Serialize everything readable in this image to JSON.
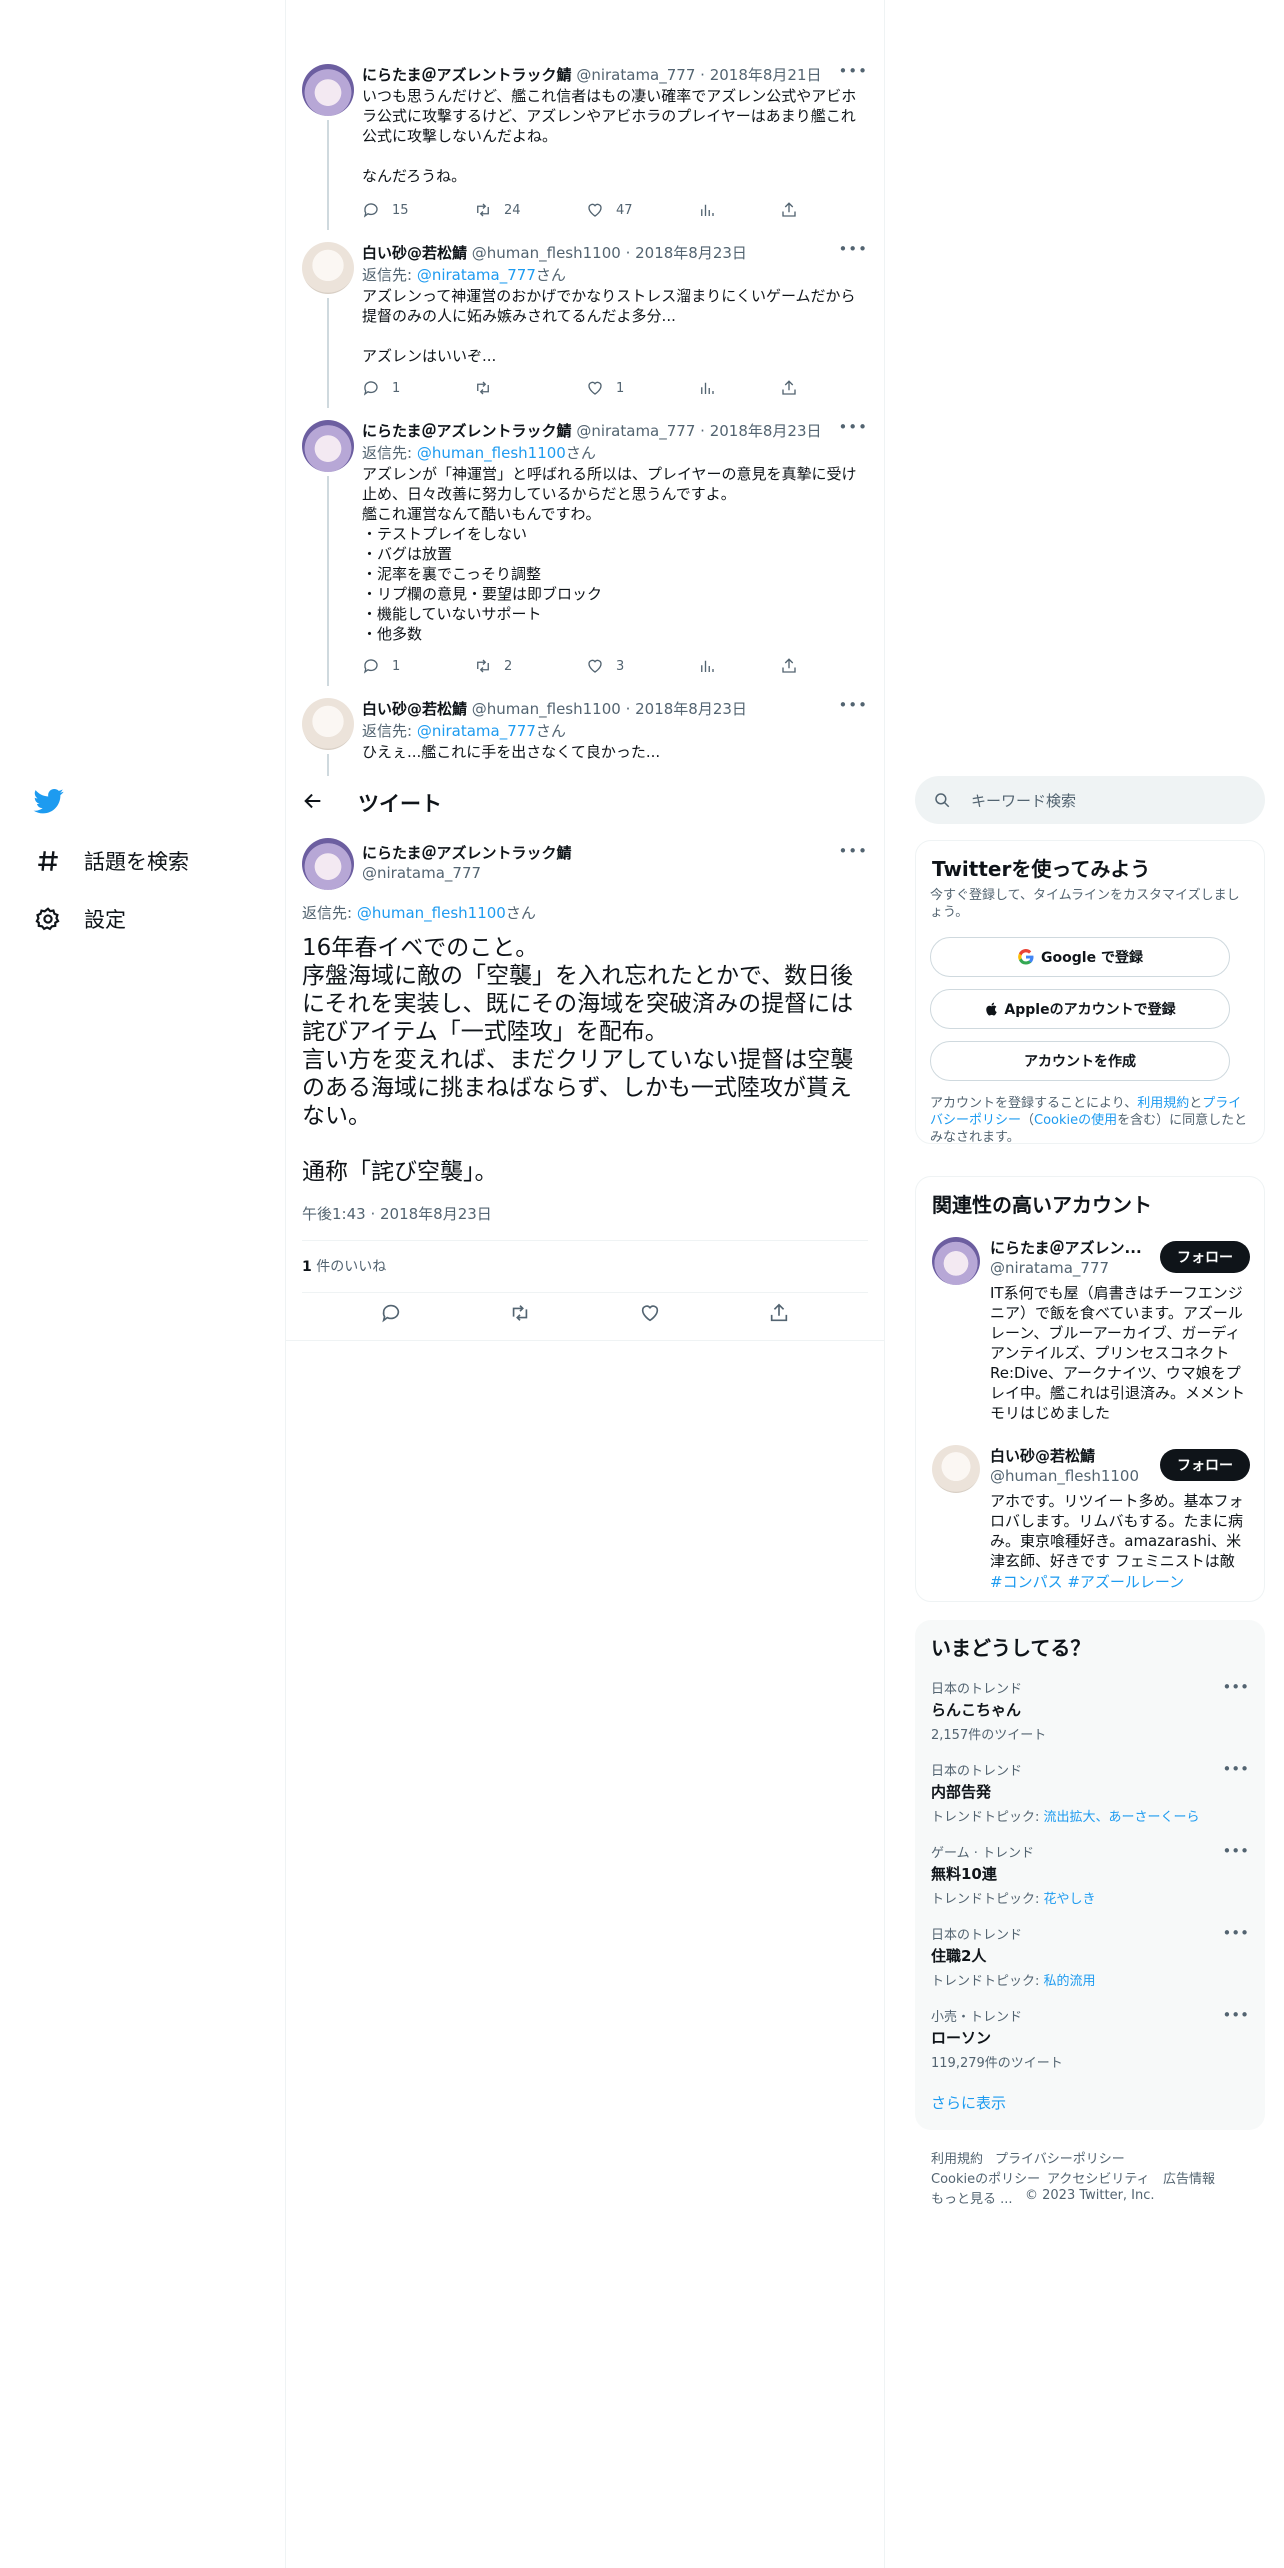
{
  "nav": {
    "explore": "話題を検索",
    "settings": "設定"
  },
  "thread": [
    {
      "name": "にらたま＠アズレントラック鯖",
      "handle": "@niratama_777",
      "date": "· 2018年8月21日",
      "reply_prefix": "",
      "reply_to": "",
      "reply_suffix": "",
      "text": "いつも思うんだけど、艦これ信者はもの凄い確率でアズレン公式やアビホラ公式に攻撃するけど、アズレンやアビホラのプレイヤーはあまり艦これ公式に攻撃しないんだよね。\n\nなんだろうね。",
      "replies": "15",
      "retweets": "24",
      "likes": "47"
    },
    {
      "name": "白い砂@若松鯖",
      "handle": "@human_flesh1100",
      "date": "· 2018年8月23日",
      "reply_prefix": "返信先: ",
      "reply_to": "@niratama_777",
      "reply_suffix": "さん",
      "text": "アズレンって神運営のおかげでかなりストレス溜まりにくいゲームだから提督のみの人に妬み嫉みされてるんだよ多分...\n\nアズレンはいいぞ...",
      "replies": "1",
      "retweets": "",
      "likes": "1"
    },
    {
      "name": "にらたま＠アズレントラック鯖",
      "handle": "@niratama_777",
      "date": "· 2018年8月23日",
      "reply_prefix": "返信先: ",
      "reply_to": "@human_flesh1100",
      "reply_suffix": "さん",
      "text": "アズレンが「神運営」と呼ばれる所以は、プレイヤーの意見を真摯に受け止め、日々改善に努力しているからだと思うんですよ。\n艦これ運営なんて酷いもんですわ。\n・テストプレイをしない\n・バグは放置\n・泥率を裏でこっそり調整\n・リプ欄の意見・要望は即ブロック\n・機能していないサポート\n・他多数",
      "replies": "1",
      "retweets": "2",
      "likes": "3"
    },
    {
      "name": "白い砂@若松鯖",
      "handle": "@human_flesh1100",
      "date": "· 2018年8月23日",
      "reply_prefix": "返信先: ",
      "reply_to": "@niratama_777",
      "reply_suffix": "さん",
      "text": "ひえぇ...艦これに手を出さなくて良かった...",
      "replies": "",
      "retweets": "",
      "likes": ""
    }
  ],
  "header": {
    "title": "ツイート"
  },
  "focused": {
    "name": "にらたま＠アズレントラック鯖",
    "handle": "@niratama_777",
    "reply_prefix": "返信先: ",
    "reply_to": "@human_flesh1100",
    "reply_suffix": "さん",
    "text": "16年春イベでのこと。\n序盤海域に敵の「空襲」を入れ忘れたとかで、数日後にそれを実装し、既にその海域を突破済みの提督には詫びアイテム「一式陸攻」を配布。\n言い方を変えれば、まだクリアしていない提督は空襲のある海域に挑まねばならず、しかも一式陸攻が貰えない。\n\n通称「詫び空襲」。",
    "timestamp": "午後1:43 · 2018年8月23日",
    "likes_count": "1",
    "likes_label": " 件のいいね"
  },
  "search": {
    "placeholder": "キーワード検索"
  },
  "signup": {
    "title": "Twitterを使ってみよう",
    "subtitle": "今すぐ登録して、タイムラインをカスタマイズしましょう。",
    "google": "Google で登録",
    "apple": "Appleのアカウントで登録",
    "create": "アカウントを作成",
    "legal_1": "アカウントを登録することにより、",
    "legal_terms": "利用規約",
    "legal_2": "と",
    "legal_privacy": "プライバシーポリシー",
    "legal_3": "（",
    "legal_cookie": "Cookieの使用",
    "legal_4": "を含む）に同意したとみなされます。"
  },
  "related": {
    "title": "関連性の高いアカウント",
    "follow_label": "フォロー",
    "accounts": [
      {
        "name": "にらたま＠アズレン...",
        "handle": "@niratama_777",
        "bio": "IT系何でも屋（肩書きはチーフエンジニア）で飯を食べています。アズールレーン、ブルーアーカイブ、ガーディアンテイルズ、プリンセスコネクトRe:Dive、アークナイツ、ウマ娘をプレイ中。艦これは引退済み。メメントモリはじめました",
        "tags": ""
      },
      {
        "name": "白い砂@若松鯖",
        "handle": "@human_flesh1100",
        "bio": "アホです。リツイート多め。基本フォロバします。リムバもする。たまに病み。東京喰種好き。amazarashi、米津玄師、好きです フェミニストは敵",
        "tags": "#コンパス #アズールレーン"
      }
    ]
  },
  "trends": {
    "title": "いまどうしてる？",
    "items": [
      {
        "category": "日本のトレンド",
        "name": "らんこちゃん",
        "meta_prefix": "",
        "meta_link": "",
        "meta": "2,157件のツイート"
      },
      {
        "category": "日本のトレンド",
        "name": "内部告発",
        "meta_prefix": "トレンドトピック: ",
        "meta_link": "流出拡大、あーさーくーら",
        "meta": ""
      },
      {
        "category": "ゲーム · トレンド",
        "name": "無料10連",
        "meta_prefix": "トレンドトピック: ",
        "meta_link": "花やしき",
        "meta": ""
      },
      {
        "category": "日本のトレンド",
        "name": "住職2人",
        "meta_prefix": "トレンドトピック: ",
        "meta_link": "私的流用",
        "meta": ""
      },
      {
        "category": "小売・トレンド",
        "name": "ローソン",
        "meta_prefix": "",
        "meta_link": "",
        "meta": "119,279件のツイート"
      }
    ],
    "show_more": "さらに表示"
  },
  "footer": {
    "terms": "利用規約",
    "privacy": "プライバシーポリシー",
    "cookie": "Cookieのポリシー",
    "accessibility": "アクセシビリティ",
    "ads": "広告情報",
    "more": "もっと見る ...",
    "copyright": "© 2023 Twitter, Inc."
  },
  "colors": {
    "accent": "#1d9bf0",
    "text": "#0f1419",
    "secondary": "#536471",
    "border": "#eff3f4"
  }
}
